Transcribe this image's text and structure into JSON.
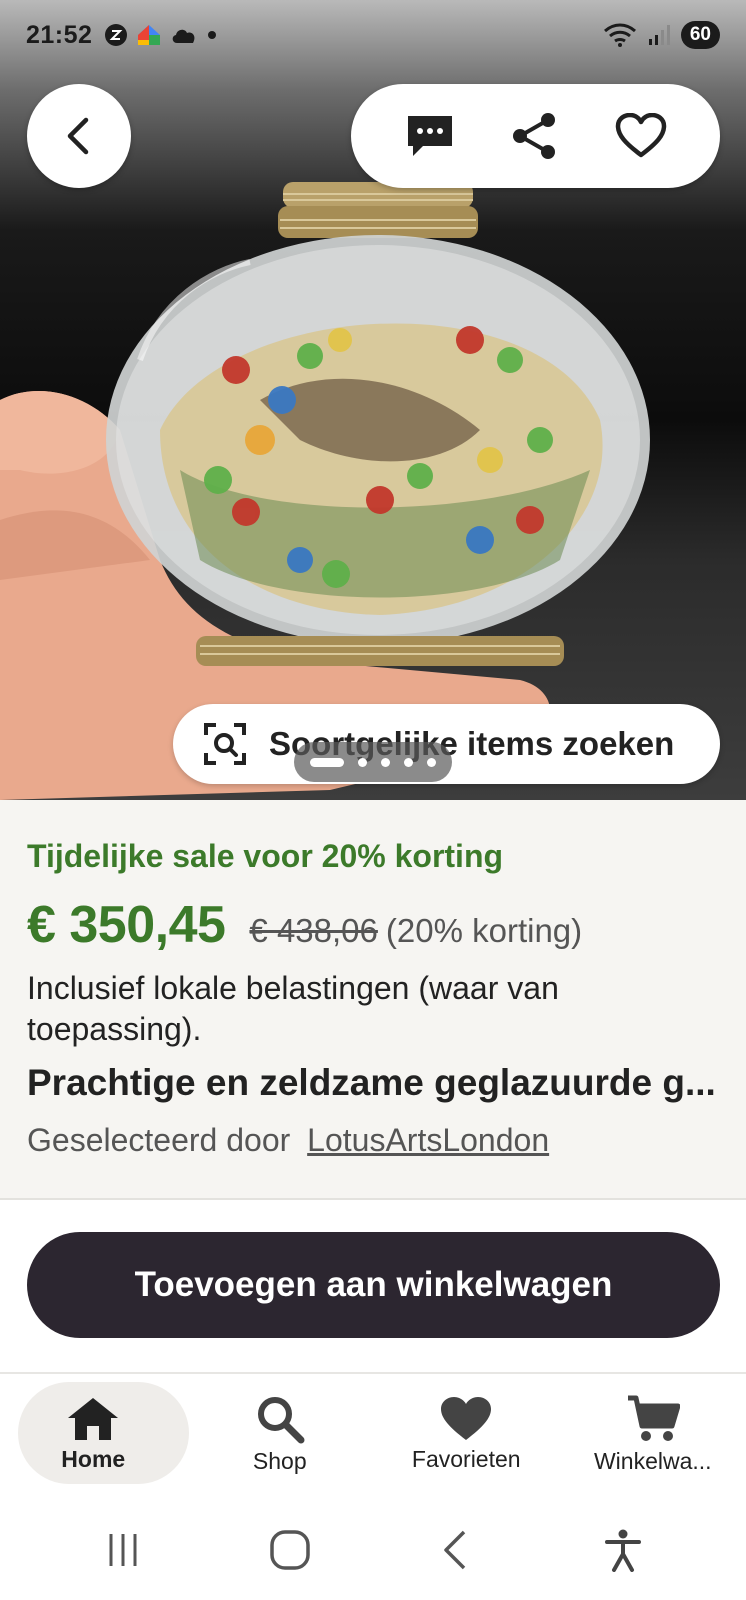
{
  "status_bar": {
    "time": "21:52",
    "battery": "60",
    "left_icons": [
      "app-notification-icon",
      "google-home-icon",
      "cloud-icon",
      "dot-icon"
    ],
    "right_icons": [
      "wifi-icon",
      "signal-icon",
      "battery-icon"
    ]
  },
  "hero": {
    "similar_items_label": "Soortgelijke items zoeken",
    "image_count": 5,
    "current_image": 1
  },
  "product": {
    "sale_text": "Tijdelijke sale voor 20% korting",
    "price_now": "€ 350,45",
    "price_old": "€ 438,06",
    "discount": "(20% korting)",
    "tax_note": "Inclusief lokale belastingen (waar van toepassing).",
    "title": "Prachtige en zeldzame geglazuurde g...",
    "seller_prefix": "Geselecteerd door",
    "seller_name": "LotusArtsLondon"
  },
  "cart_button": {
    "label": "Toevoegen aan winkelwagen"
  },
  "bottom_nav": {
    "items": [
      {
        "label": "Home",
        "icon": "home-icon",
        "active": true
      },
      {
        "label": "Shop",
        "icon": "search-icon",
        "active": false
      },
      {
        "label": "Favorieten",
        "icon": "heart-icon",
        "active": false
      },
      {
        "label": "Winkelwa...",
        "icon": "cart-icon",
        "active": false
      }
    ]
  },
  "colors": {
    "sale_green": "#3c7a2a",
    "cart_button_bg": "#2c2630",
    "panel_bg": "#f6f5f2"
  }
}
